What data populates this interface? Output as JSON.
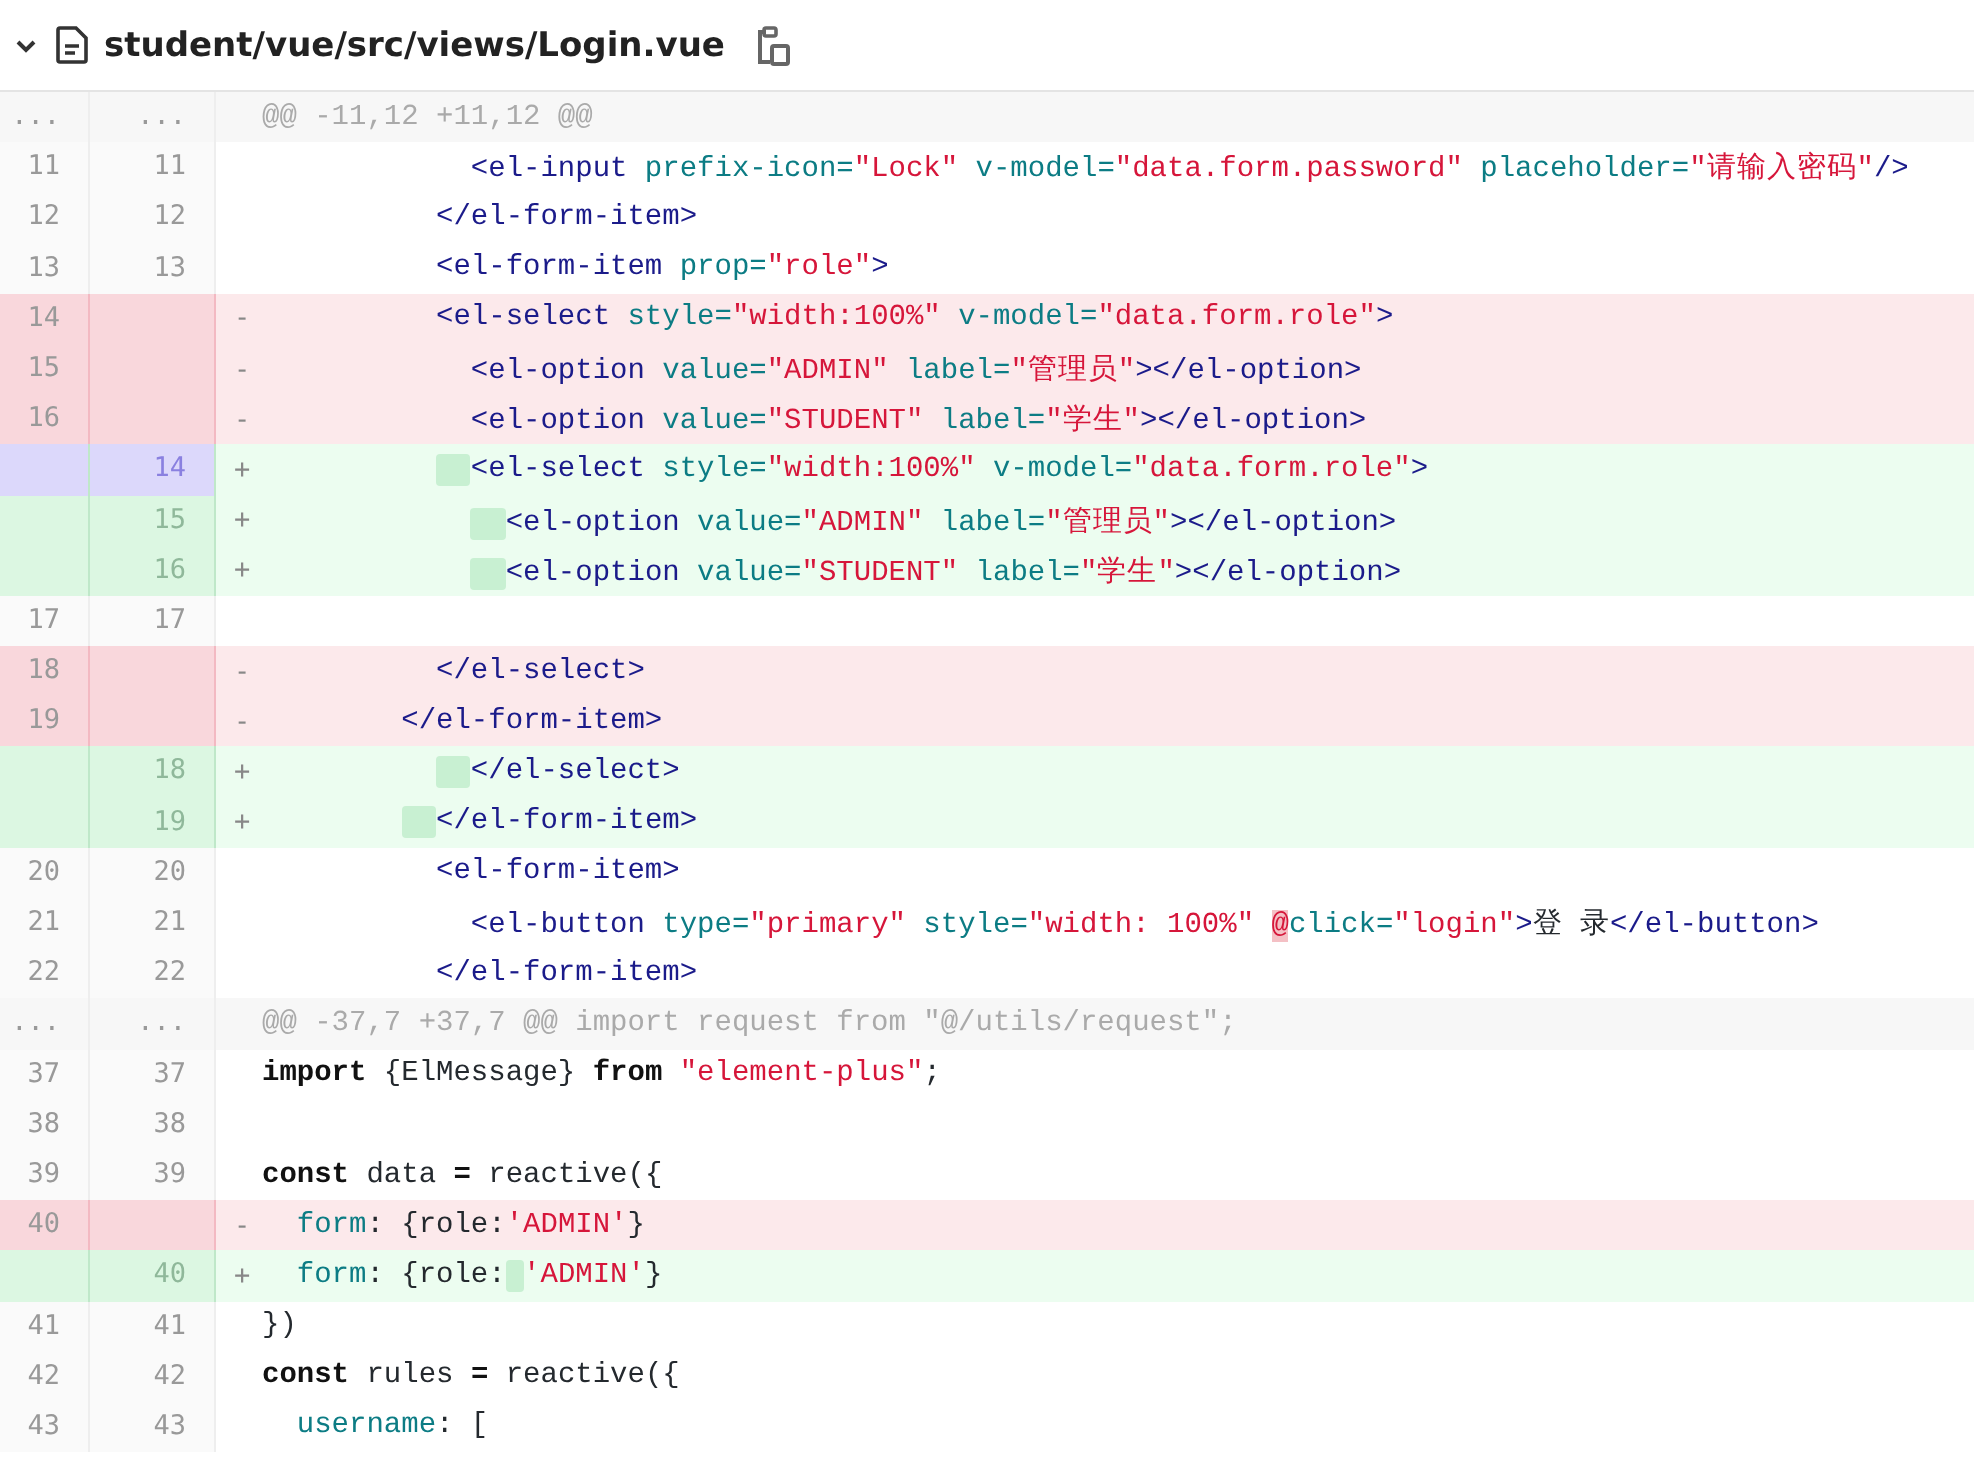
{
  "file": {
    "path": "student/vue/src/views/Login.vue",
    "expanded": true
  },
  "lines": [
    {
      "kind": "hunk",
      "old": "...",
      "new": "...",
      "text": "@@ -11,12 +11,12 @@"
    },
    {
      "kind": "context",
      "old": "11",
      "new": "11",
      "selected": false,
      "tokens": [
        {
          "kind": "tag",
          "s": "            <el-input"
        },
        {
          "kind": "attr",
          "s": " prefix-icon="
        },
        {
          "kind": "string",
          "s": "\"Lock\""
        },
        {
          "kind": "attr",
          "s": " v-model="
        },
        {
          "kind": "string",
          "s": "\"data.form.password\""
        },
        {
          "kind": "attr",
          "s": " placeholder="
        },
        {
          "kind": "string",
          "s": "\"请输入密码\""
        },
        {
          "kind": "tag",
          "s": "/>"
        }
      ]
    },
    {
      "kind": "context",
      "old": "12",
      "new": "12",
      "selected": false,
      "tokens": [
        {
          "kind": "tag",
          "s": "          </el-form-item>"
        }
      ]
    },
    {
      "kind": "context",
      "old": "13",
      "new": "13",
      "selected": false,
      "tokens": [
        {
          "kind": "tag",
          "s": "          <el-form-item"
        },
        {
          "kind": "attr",
          "s": " prop="
        },
        {
          "kind": "string",
          "s": "\"role\""
        },
        {
          "kind": "tag",
          "s": ">"
        }
      ]
    },
    {
      "kind": "removed",
      "old": "14",
      "marker": "-",
      "selected": false,
      "tokens": [
        {
          "kind": "tag",
          "s": "          <el-select"
        },
        {
          "kind": "attr",
          "s": " style="
        },
        {
          "kind": "string",
          "s": "\"width:100%\""
        },
        {
          "kind": "attr",
          "s": " v-model="
        },
        {
          "kind": "string",
          "s": "\"data.form.role\""
        },
        {
          "kind": "tag",
          "s": ">"
        }
      ]
    },
    {
      "kind": "removed",
      "old": "15",
      "marker": "-",
      "selected": false,
      "tokens": [
        {
          "kind": "tag",
          "s": "            <el-option"
        },
        {
          "kind": "attr",
          "s": " value="
        },
        {
          "kind": "string",
          "s": "\"ADMIN\""
        },
        {
          "kind": "attr",
          "s": " label="
        },
        {
          "kind": "string",
          "s": "\"管理员\""
        },
        {
          "kind": "tag",
          "s": "></el-option>"
        }
      ]
    },
    {
      "kind": "removed",
      "old": "16",
      "marker": "-",
      "selected": false,
      "tokens": [
        {
          "kind": "tag",
          "s": "            <el-option"
        },
        {
          "kind": "attr",
          "s": " value="
        },
        {
          "kind": "string",
          "s": "\"STUDENT\""
        },
        {
          "kind": "attr",
          "s": " label="
        },
        {
          "kind": "string",
          "s": "\"学生\""
        },
        {
          "kind": "tag",
          "s": "></el-option>"
        }
      ]
    },
    {
      "kind": "added",
      "new": "14",
      "marker": "+",
      "selected": true,
      "tokens": [
        {
          "kind": "tag",
          "s": "            <el-select",
          "inserted": true
        },
        {
          "kind": "attr",
          "s": " style="
        },
        {
          "kind": "string",
          "s": "\"width:100%\""
        },
        {
          "kind": "attr",
          "s": " v-model="
        },
        {
          "kind": "string",
          "s": "\"data.form.role\""
        },
        {
          "kind": "tag",
          "s": ">"
        }
      ]
    },
    {
      "kind": "added",
      "new": "15",
      "marker": "+",
      "selected": false,
      "tokens": [
        {
          "kind": "tag",
          "s": "              <el-option",
          "inserted": true
        },
        {
          "kind": "attr",
          "s": " value="
        },
        {
          "kind": "string",
          "s": "\"ADMIN\""
        },
        {
          "kind": "attr",
          "s": " label="
        },
        {
          "kind": "string",
          "s": "\"管理员\""
        },
        {
          "kind": "tag",
          "s": "></el-option>"
        }
      ]
    },
    {
      "kind": "added",
      "new": "16",
      "marker": "+",
      "selected": false,
      "tokens": [
        {
          "kind": "tag",
          "s": "              <el-option",
          "inserted": true
        },
        {
          "kind": "attr",
          "s": " value="
        },
        {
          "kind": "string",
          "s": "\"STUDENT\""
        },
        {
          "kind": "attr",
          "s": " label="
        },
        {
          "kind": "string",
          "s": "\"学生\""
        },
        {
          "kind": "tag",
          "s": "></el-option>"
        }
      ]
    },
    {
      "kind": "context",
      "old": "17",
      "new": "17",
      "selected": false
    },
    {
      "kind": "removed",
      "old": "18",
      "marker": "-",
      "selected": false,
      "tokens": [
        {
          "kind": "tag",
          "s": "          </el-select>"
        }
      ]
    },
    {
      "kind": "removed",
      "old": "19",
      "marker": "-",
      "selected": false,
      "tokens": [
        {
          "kind": "tag",
          "s": "        </el-form-item>"
        }
      ]
    },
    {
      "kind": "added",
      "new": "18",
      "marker": "+",
      "selected": false,
      "tokens": [
        {
          "kind": "tag",
          "s": "            </el-select>",
          "inserted": true
        }
      ]
    },
    {
      "kind": "added",
      "new": "19",
      "marker": "+",
      "selected": false,
      "tokens": [
        {
          "kind": "tag",
          "s": "          </el-form-item>",
          "inserted": true
        }
      ]
    },
    {
      "kind": "context",
      "old": "20",
      "new": "20",
      "selected": false,
      "tokens": [
        {
          "kind": "tag",
          "s": "          <el-form-item>"
        }
      ]
    },
    {
      "kind": "context",
      "old": "21",
      "new": "21",
      "selected": false,
      "tokens": [
        {
          "kind": "tag",
          "s": "            <el-button"
        },
        {
          "kind": "attr",
          "s": " type="
        },
        {
          "kind": "string",
          "s": "\"primary\""
        },
        {
          "kind": "attr",
          "s": " style="
        },
        {
          "kind": "string",
          "s": "\"width: 100%\""
        },
        {
          "kind": "error",
          "s": " @"
        },
        {
          "kind": "attr",
          "s": "click="
        },
        {
          "kind": "string",
          "s": "\"login\""
        },
        {
          "kind": "tag",
          "s": ">"
        },
        {
          "kind": "plain",
          "s": "登 录"
        },
        {
          "kind": "tag",
          "s": "</el-button>"
        }
      ]
    },
    {
      "kind": "context",
      "old": "22",
      "new": "22",
      "selected": false,
      "tokens": [
        {
          "kind": "tag",
          "s": "          </el-form-item>"
        }
      ]
    },
    {
      "kind": "hunk",
      "old": "...",
      "new": "...",
      "text": "@@ -37,7 +37,7 @@ import request from \"@/utils/request\";"
    },
    {
      "kind": "context",
      "old": "37",
      "new": "37",
      "selected": false,
      "tokens": [
        {
          "kind": "keyword",
          "s": "import"
        },
        {
          "kind": "plain",
          "s": " {ElMessage} "
        },
        {
          "kind": "keyword",
          "s": "from"
        },
        {
          "kind": "string",
          "s": " \"element-plus\""
        },
        {
          "kind": "plain",
          "s": ";"
        }
      ]
    },
    {
      "kind": "context",
      "old": "38",
      "new": "38",
      "selected": false
    },
    {
      "kind": "context",
      "old": "39",
      "new": "39",
      "selected": false,
      "tokens": [
        {
          "kind": "keyword",
          "s": "const"
        },
        {
          "kind": "plain",
          "s": " data "
        },
        {
          "kind": "keyword",
          "s": "="
        },
        {
          "kind": "plain",
          "s": " reactive({"
        }
      ]
    },
    {
      "kind": "removed",
      "old": "40",
      "marker": "-",
      "selected": false,
      "tokens": [
        {
          "kind": "attr",
          "s": "  form"
        },
        {
          "kind": "plain",
          "s": ": {role:"
        },
        {
          "kind": "string",
          "s": "'ADMIN'"
        },
        {
          "kind": "plain",
          "s": "}"
        }
      ]
    },
    {
      "kind": "added",
      "new": "40",
      "marker": "+",
      "selected": false,
      "tokens": [
        {
          "kind": "attr",
          "s": "  form"
        },
        {
          "kind": "plain",
          "s": ": {role:"
        },
        {
          "kind": "string",
          "s": " 'ADMIN'",
          "inserted": true
        },
        {
          "kind": "plain",
          "s": "}"
        }
      ]
    },
    {
      "kind": "context",
      "old": "41",
      "new": "41",
      "selected": false,
      "tokens": [
        {
          "kind": "plain",
          "s": "})"
        }
      ]
    },
    {
      "kind": "context",
      "old": "42",
      "new": "42",
      "selected": false,
      "tokens": [
        {
          "kind": "keyword",
          "s": "const"
        },
        {
          "kind": "plain",
          "s": " rules "
        },
        {
          "kind": "keyword",
          "s": "="
        },
        {
          "kind": "plain",
          "s": " reactive({"
        }
      ]
    },
    {
      "kind": "context",
      "old": "43",
      "new": "43",
      "selected": false,
      "tokens": [
        {
          "kind": "attr",
          "s": "  username"
        },
        {
          "kind": "plain",
          "s": ": ["
        }
      ]
    }
  ]
}
